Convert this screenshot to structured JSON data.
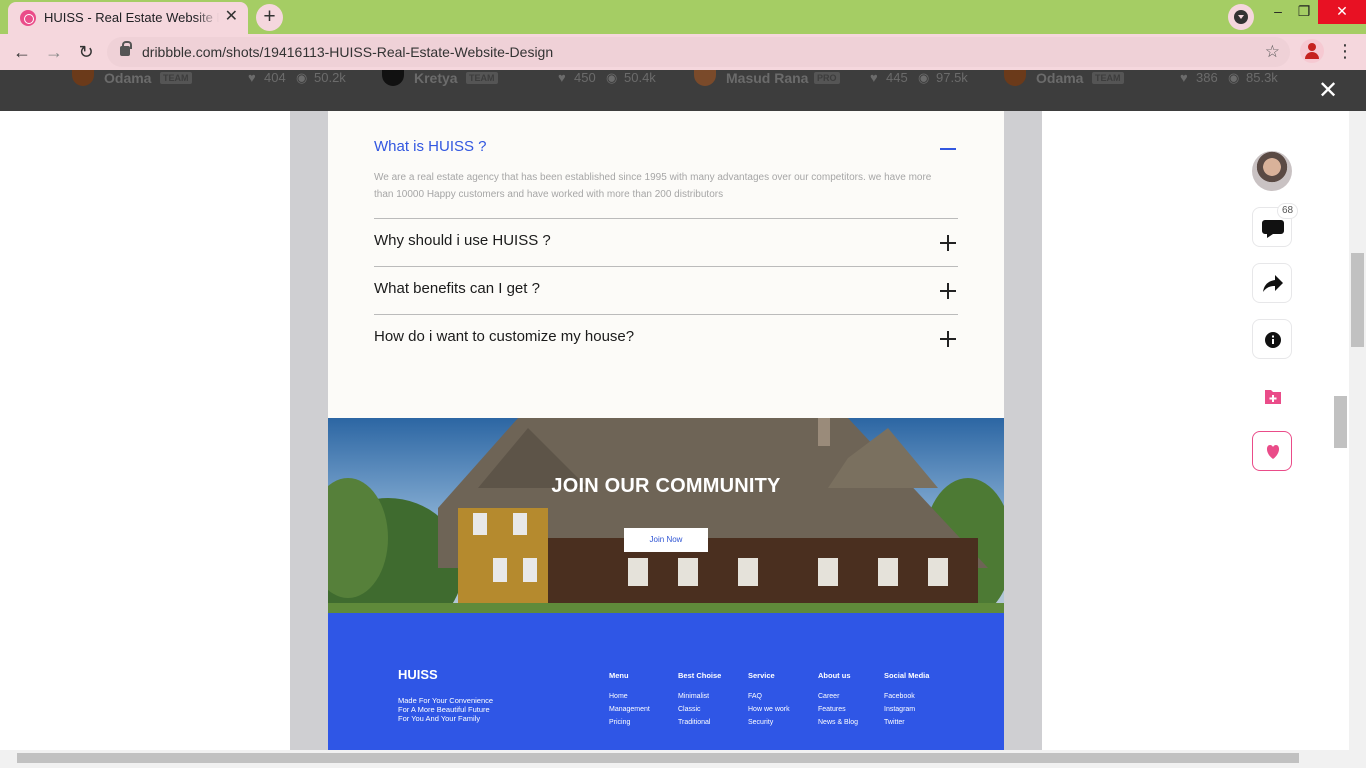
{
  "browser": {
    "tab_title": "HUISS - Real Estate Website Design",
    "tab_close": "✕",
    "new_tab": "+",
    "url": "dribbble.com/shots/19416113-HUISS-Real-Estate-Website-Design",
    "window_controls": {
      "minimize": "–",
      "maximize": "❐",
      "close": "✕"
    },
    "nav": {
      "back": "←",
      "forward": "→",
      "reload": "↻"
    },
    "bookmark_star": "☆",
    "menu": "⋮"
  },
  "strip": {
    "items": [
      {
        "name": "Odama",
        "badge": "TEAM",
        "likes": "404",
        "views": "50.2k",
        "avatar_color": "#6b3a1a"
      },
      {
        "name": "Kretya",
        "badge": "TEAM",
        "likes": "450",
        "views": "50.4k",
        "avatar_color": "#111111"
      },
      {
        "name": "Masud Rana",
        "badge": "PRO",
        "likes": "445",
        "views": "97.5k",
        "avatar_color": "#7a4a2a"
      },
      {
        "name": "Odama",
        "badge": "TEAM",
        "likes": "386",
        "views": "85.3k",
        "avatar_color": "#6b3a1a"
      }
    ],
    "like_icon": "♥",
    "view_icon": "◉",
    "close": "✕"
  },
  "faq": {
    "open_question": "What is HUISS ?",
    "open_answer": "We are a real estate agency that has been established since 1995 with many advantages over our competitors. we have more than 10000 Happy customers and have worked with more than 200 distributors",
    "questions": [
      "Why should i use HUISS ?",
      "What benefits can I get ?",
      "How do i want to customize my house?"
    ]
  },
  "community": {
    "title": "JOIN OUR COMMUNITY",
    "button": "Join Now"
  },
  "footer": {
    "logo": "HUISS",
    "tagline": [
      "Made For Your Convenience",
      "For A More Beautiful Future",
      "For You And Your Family"
    ],
    "columns": [
      {
        "heading": "Menu",
        "links": [
          "Home",
          "Management",
          "Pricing"
        ]
      },
      {
        "heading": "Best Choise",
        "links": [
          "Minimalist",
          "Classic",
          "Traditional"
        ]
      },
      {
        "heading": "Service",
        "links": [
          "FAQ",
          "How we work",
          "Security"
        ]
      },
      {
        "heading": "About us",
        "links": [
          "Career",
          "Features",
          "News & Blog"
        ]
      },
      {
        "heading": "Social Media",
        "links": [
          "Facebook",
          "Instagram",
          "Twitter"
        ]
      }
    ]
  },
  "side_actions": {
    "comment_count": "68",
    "icons": [
      "comment-icon",
      "share-icon",
      "info-icon",
      "add-collection-icon",
      "heart-icon"
    ]
  },
  "colors": {
    "accent_blue": "#3257e0",
    "footer_blue": "#2f56e6",
    "dribbble_pink": "#ea4c89",
    "tab_green": "#a5cd64"
  }
}
